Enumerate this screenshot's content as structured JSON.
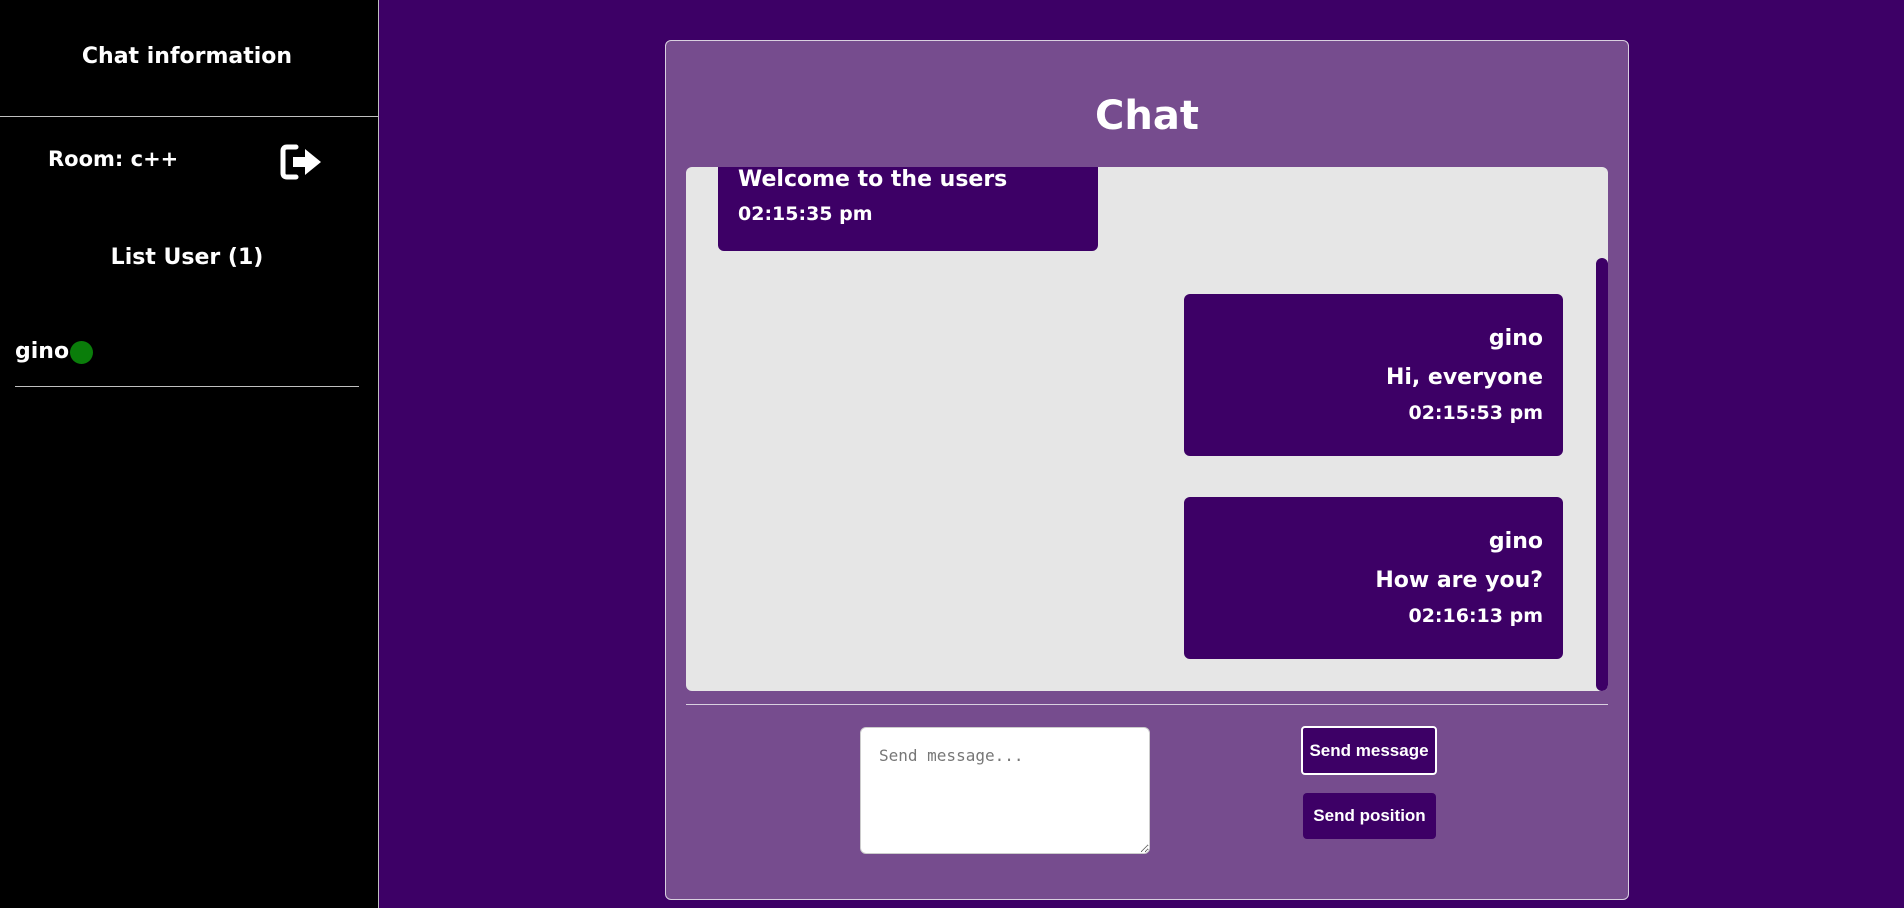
{
  "sidebar": {
    "title": "Chat information",
    "room_label": "Room: c++",
    "logout_icon": "sign-out-icon",
    "list_title": "List User (1)",
    "users": [
      {
        "name": "gino",
        "status": "online",
        "status_color": "#0a7d0a"
      }
    ]
  },
  "chat": {
    "title": "Chat",
    "messages": [
      {
        "type": "system",
        "text": "Welcome to the users",
        "time": "02:15:35 pm"
      },
      {
        "type": "user",
        "sender": "gino",
        "text": "Hi, everyone",
        "time": "02:15:53 pm"
      },
      {
        "type": "user",
        "sender": "gino",
        "text": "How are you?",
        "time": "02:16:13 pm"
      }
    ],
    "input": {
      "placeholder": "Send message...",
      "value": ""
    },
    "send_message_label": "Send message",
    "send_position_label": "Send position"
  },
  "colors": {
    "background": "#3d0066",
    "panel": "#764c8e",
    "sidebar": "#000000",
    "message_area": "#e6e6e6",
    "bubble": "#3d0066"
  }
}
